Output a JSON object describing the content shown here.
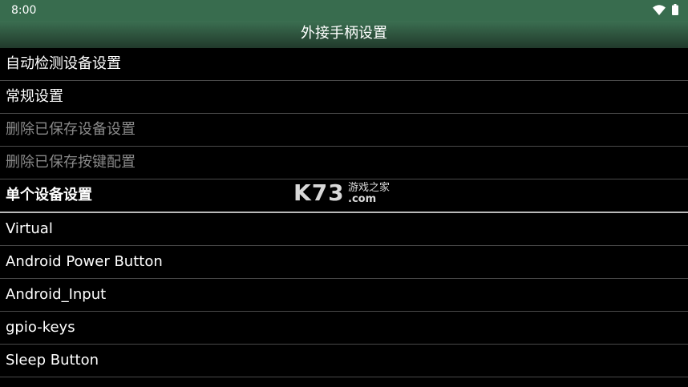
{
  "status_bar": {
    "time": "8:00",
    "icons": [
      "wifi-icon",
      "battery-icon"
    ]
  },
  "title_bar": {
    "title": "外接手柄设置"
  },
  "menu": {
    "items": [
      {
        "label": "自动检测设备设置",
        "enabled": true
      },
      {
        "label": "常规设置",
        "enabled": true
      },
      {
        "label": "删除已保存设备设置",
        "enabled": false
      },
      {
        "label": "删除已保存按键配置",
        "enabled": false
      }
    ],
    "section_header": "单个设备设置",
    "devices": [
      "Virtual",
      "Android Power Button",
      "Android_Input",
      "gpio-keys",
      "Sleep Button"
    ]
  },
  "watermark": {
    "logo": "K73",
    "site_name": "游戏之家",
    "domain": ".com"
  },
  "colors": {
    "status_bar": "#386c4e",
    "title_bar": "#2c4d3a",
    "background": "#000000",
    "divider": "#4a4a4a",
    "disabled_text": "#8a8a8a"
  }
}
